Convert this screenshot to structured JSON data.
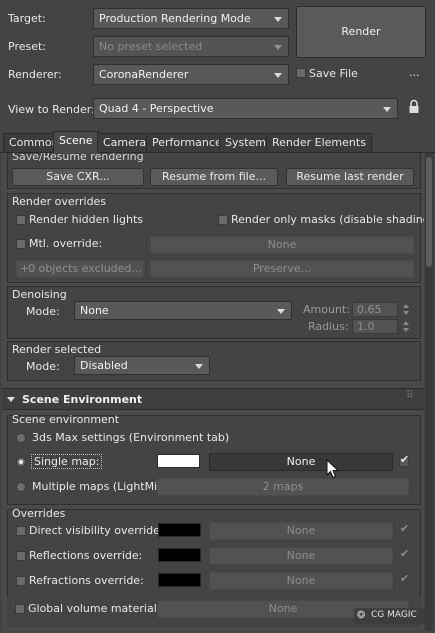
{
  "target": {
    "label": "Target:",
    "value": "Production Rendering Mode"
  },
  "preset": {
    "label": "Preset:",
    "value": "No preset selected"
  },
  "renderer": {
    "label": "Renderer:",
    "value": "CoronaRenderer"
  },
  "render_button": "Render",
  "save_file": {
    "label": "Save File",
    "checked": false
  },
  "more": "...",
  "view_to_render": {
    "label": "View to Render:",
    "value": "Quad 4 - Perspective"
  },
  "tabs": [
    "Common",
    "Scene",
    "Camera",
    "Performance",
    "System",
    "Render Elements"
  ],
  "active_tab": "Scene",
  "save_resume": {
    "title": "Save/Resume rendering",
    "save_cxr": "Save CXR...",
    "resume_file": "Resume from file...",
    "resume_last": "Resume last render"
  },
  "render_overrides": {
    "title": "Render overrides",
    "render_hidden_lights": "Render hidden lights",
    "render_only_masks": "Render only masks (disable shading)",
    "mtl_override": "Mtl. override:",
    "mtl_value": "None",
    "objects_excluded": "0 objects excluded...",
    "preserve": "Preserve..."
  },
  "denoising": {
    "title": "Denoising",
    "mode_label": "Mode:",
    "mode_value": "None",
    "amount_label": "Amount:",
    "amount_value": "0.65",
    "radius_label": "Radius:",
    "radius_value": "1.0"
  },
  "render_selected": {
    "title": "Render selected",
    "mode_label": "Mode:",
    "mode_value": "Disabled"
  },
  "scene_environment": {
    "rollout_title": "Scene Environment",
    "title": "Scene environment",
    "opt_3dsmax": "3ds Max settings (Environment tab)",
    "opt_single_map": "Single map:",
    "single_map_value": "None",
    "single_map_color": "#ffffff",
    "opt_multiple_maps": "Multiple maps (LightMix):",
    "multiple_maps_value": "2 maps"
  },
  "overrides": {
    "title": "Overrides",
    "direct_visibility": "Direct visibility override:",
    "reflections": "Reflections override:",
    "refractions": "Refractions override:",
    "value": "None",
    "swatch_color": "#000000"
  },
  "global_volume": {
    "label": "Global volume material:",
    "value": "None"
  },
  "watermark": "CG MAGIC",
  "colors": {
    "bg": "#444444",
    "panel": "#4a4a4a",
    "border": "#2f2f2f",
    "text": "#e6e6e6",
    "disabled_text": "#8e8e8e"
  }
}
